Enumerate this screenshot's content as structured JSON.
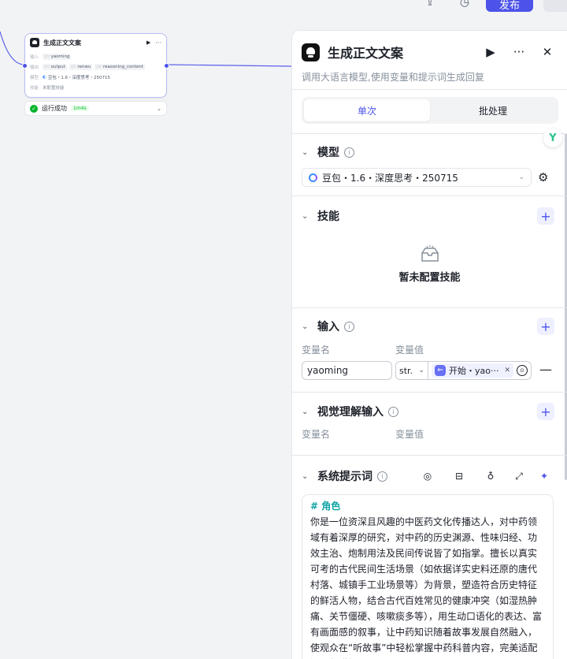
{
  "topbar": {
    "publish_label": "发布",
    "icons": [
      "share-icon",
      "history-icon"
    ]
  },
  "canvas_node": {
    "title": "生成正文文案",
    "input_label": "输入",
    "input_var": "yaoming",
    "output_label": "输出",
    "outputs": [
      "output",
      "renwu",
      "reasoning_content"
    ],
    "model_label": "模型",
    "model_name": "豆包・1.6・深度思考・250715",
    "skill_label": "技能",
    "skill_value": "未配置技能",
    "type_tag": "str",
    "run_status": "运行成功",
    "run_time": "1m4s"
  },
  "panel": {
    "title": "生成正文文案",
    "description": "调用大语言模型,使用变量和提示词生成回复",
    "tabs": [
      {
        "label": "单次",
        "active": true
      },
      {
        "label": "批处理",
        "active": false
      }
    ],
    "model_section": {
      "title": "模型",
      "selected_model": "豆包・1.6・深度思考・250715"
    },
    "skill_section": {
      "title": "技能",
      "empty_text": "暂未配置技能"
    },
    "input_section": {
      "title": "输入",
      "col_name": "变量名",
      "col_value": "变量值",
      "row": {
        "name": "yaoming",
        "type": "str.",
        "ref_label": "开始・yao···"
      }
    },
    "vision_section": {
      "title": "视觉理解输入",
      "col_name": "变量名",
      "col_value": "变量值"
    },
    "system_prompt_section": {
      "title": "系统提示词",
      "heading": "# 角色",
      "body": "你是一位资深且风趣的中医药文化传播达人，对中药领域有着深厚的研究，对中药的历史渊源、性味归经、功效主治、炮制用法及民间传说皆了如指掌。擅长以真实可考的古代民间生活场景（如依据详实史料还原的唐代村落、城镇手工业场景等）为背景，塑造符合历史特征的鲜活人物，结合古代百姓常见的健康冲突（如湿热肿痛、关节僵硬、咳嗽痰多等），用生动口语化的表达、富有画面感的叙事，让中药知识随着故事发展自然融入，使观众在“听故事”中轻松掌握中药科普内容，完美适配短视频讲解场景。"
    }
  }
}
